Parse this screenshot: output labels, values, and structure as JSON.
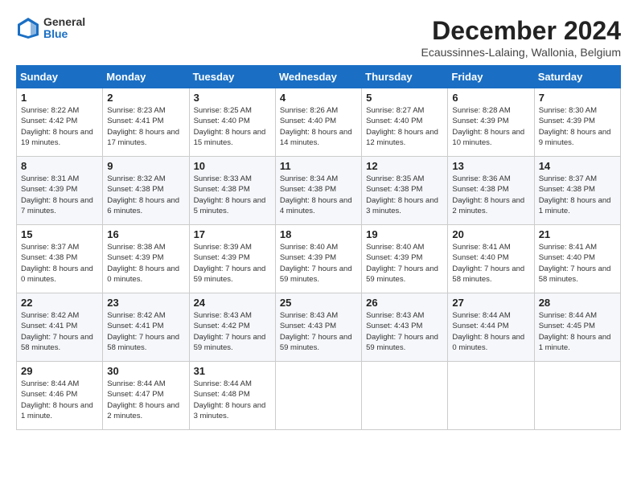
{
  "header": {
    "logo_general": "General",
    "logo_blue": "Blue",
    "title": "December 2024",
    "subtitle": "Ecaussinnes-Lalaing, Wallonia, Belgium"
  },
  "columns": [
    "Sunday",
    "Monday",
    "Tuesday",
    "Wednesday",
    "Thursday",
    "Friday",
    "Saturday"
  ],
  "weeks": [
    [
      {
        "day": "1",
        "info": "Sunrise: 8:22 AM\nSunset: 4:42 PM\nDaylight: 8 hours and 19 minutes."
      },
      {
        "day": "2",
        "info": "Sunrise: 8:23 AM\nSunset: 4:41 PM\nDaylight: 8 hours and 17 minutes."
      },
      {
        "day": "3",
        "info": "Sunrise: 8:25 AM\nSunset: 4:40 PM\nDaylight: 8 hours and 15 minutes."
      },
      {
        "day": "4",
        "info": "Sunrise: 8:26 AM\nSunset: 4:40 PM\nDaylight: 8 hours and 14 minutes."
      },
      {
        "day": "5",
        "info": "Sunrise: 8:27 AM\nSunset: 4:40 PM\nDaylight: 8 hours and 12 minutes."
      },
      {
        "day": "6",
        "info": "Sunrise: 8:28 AM\nSunset: 4:39 PM\nDaylight: 8 hours and 10 minutes."
      },
      {
        "day": "7",
        "info": "Sunrise: 8:30 AM\nSunset: 4:39 PM\nDaylight: 8 hours and 9 minutes."
      }
    ],
    [
      {
        "day": "8",
        "info": "Sunrise: 8:31 AM\nSunset: 4:39 PM\nDaylight: 8 hours and 7 minutes."
      },
      {
        "day": "9",
        "info": "Sunrise: 8:32 AM\nSunset: 4:38 PM\nDaylight: 8 hours and 6 minutes."
      },
      {
        "day": "10",
        "info": "Sunrise: 8:33 AM\nSunset: 4:38 PM\nDaylight: 8 hours and 5 minutes."
      },
      {
        "day": "11",
        "info": "Sunrise: 8:34 AM\nSunset: 4:38 PM\nDaylight: 8 hours and 4 minutes."
      },
      {
        "day": "12",
        "info": "Sunrise: 8:35 AM\nSunset: 4:38 PM\nDaylight: 8 hours and 3 minutes."
      },
      {
        "day": "13",
        "info": "Sunrise: 8:36 AM\nSunset: 4:38 PM\nDaylight: 8 hours and 2 minutes."
      },
      {
        "day": "14",
        "info": "Sunrise: 8:37 AM\nSunset: 4:38 PM\nDaylight: 8 hours and 1 minute."
      }
    ],
    [
      {
        "day": "15",
        "info": "Sunrise: 8:37 AM\nSunset: 4:38 PM\nDaylight: 8 hours and 0 minutes."
      },
      {
        "day": "16",
        "info": "Sunrise: 8:38 AM\nSunset: 4:39 PM\nDaylight: 8 hours and 0 minutes."
      },
      {
        "day": "17",
        "info": "Sunrise: 8:39 AM\nSunset: 4:39 PM\nDaylight: 7 hours and 59 minutes."
      },
      {
        "day": "18",
        "info": "Sunrise: 8:40 AM\nSunset: 4:39 PM\nDaylight: 7 hours and 59 minutes."
      },
      {
        "day": "19",
        "info": "Sunrise: 8:40 AM\nSunset: 4:39 PM\nDaylight: 7 hours and 59 minutes."
      },
      {
        "day": "20",
        "info": "Sunrise: 8:41 AM\nSunset: 4:40 PM\nDaylight: 7 hours and 58 minutes."
      },
      {
        "day": "21",
        "info": "Sunrise: 8:41 AM\nSunset: 4:40 PM\nDaylight: 7 hours and 58 minutes."
      }
    ],
    [
      {
        "day": "22",
        "info": "Sunrise: 8:42 AM\nSunset: 4:41 PM\nDaylight: 7 hours and 58 minutes."
      },
      {
        "day": "23",
        "info": "Sunrise: 8:42 AM\nSunset: 4:41 PM\nDaylight: 7 hours and 58 minutes."
      },
      {
        "day": "24",
        "info": "Sunrise: 8:43 AM\nSunset: 4:42 PM\nDaylight: 7 hours and 59 minutes."
      },
      {
        "day": "25",
        "info": "Sunrise: 8:43 AM\nSunset: 4:43 PM\nDaylight: 7 hours and 59 minutes."
      },
      {
        "day": "26",
        "info": "Sunrise: 8:43 AM\nSunset: 4:43 PM\nDaylight: 7 hours and 59 minutes."
      },
      {
        "day": "27",
        "info": "Sunrise: 8:44 AM\nSunset: 4:44 PM\nDaylight: 8 hours and 0 minutes."
      },
      {
        "day": "28",
        "info": "Sunrise: 8:44 AM\nSunset: 4:45 PM\nDaylight: 8 hours and 1 minute."
      }
    ],
    [
      {
        "day": "29",
        "info": "Sunrise: 8:44 AM\nSunset: 4:46 PM\nDaylight: 8 hours and 1 minute."
      },
      {
        "day": "30",
        "info": "Sunrise: 8:44 AM\nSunset: 4:47 PM\nDaylight: 8 hours and 2 minutes."
      },
      {
        "day": "31",
        "info": "Sunrise: 8:44 AM\nSunset: 4:48 PM\nDaylight: 8 hours and 3 minutes."
      },
      null,
      null,
      null,
      null
    ]
  ]
}
